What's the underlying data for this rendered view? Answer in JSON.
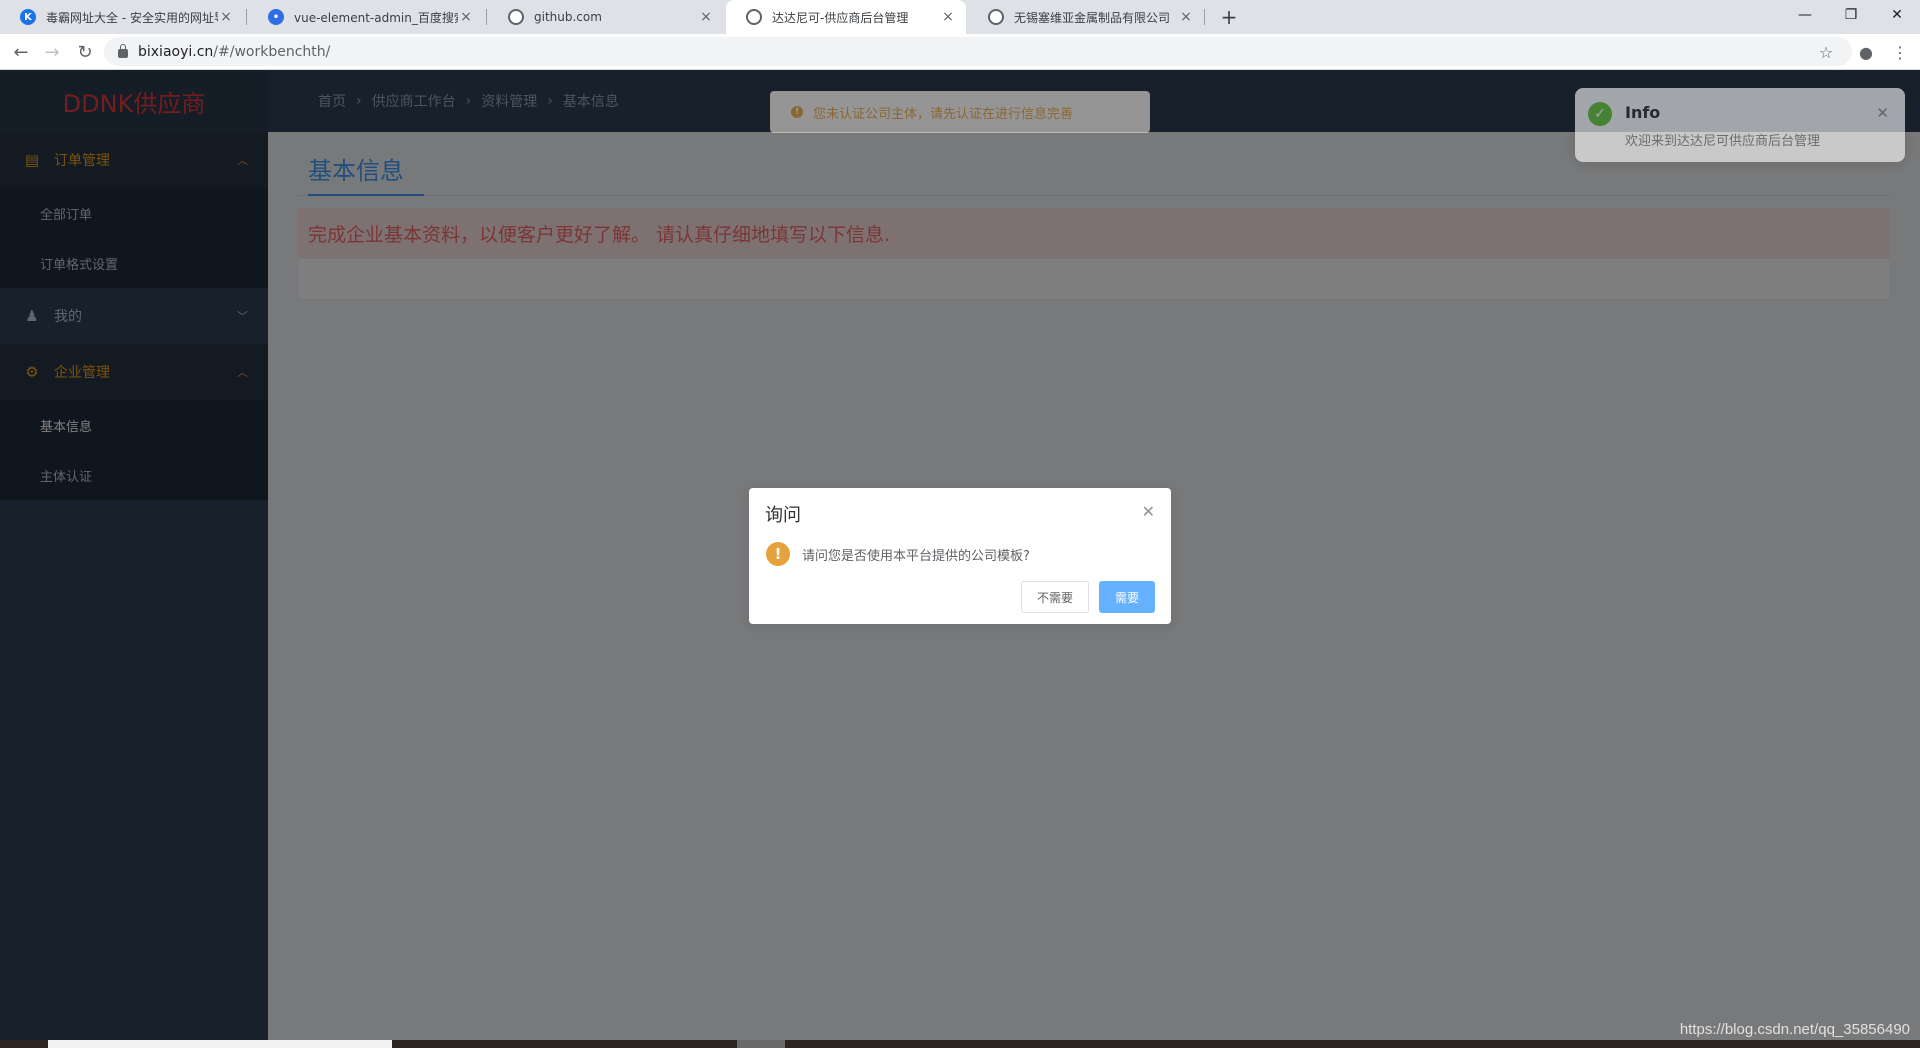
{
  "browser": {
    "tabs": [
      {
        "title": "毒霸网址大全 - 安全实用的网址导",
        "icon": "kingsoft-icon",
        "active": false
      },
      {
        "title": "vue-element-admin_百度搜索",
        "icon": "baidu-icon",
        "active": false
      },
      {
        "title": "github.com",
        "icon": "globe-icon",
        "active": false
      },
      {
        "title": "达达尼可-供应商后台管理",
        "icon": "globe-icon",
        "active": true
      },
      {
        "title": "无锡塞维亚金属制品有限公司",
        "icon": "globe-icon",
        "active": false
      }
    ],
    "url_host": "bixiaoyi.cn",
    "url_path": "/#/workbenchth/"
  },
  "sidebar": {
    "logo": "DDNK供应商",
    "group_order": "订单管理",
    "items_order": [
      {
        "label": "全部订单"
      },
      {
        "label": "订单格式设置"
      }
    ],
    "group_me": "我的",
    "group_company": "企业管理",
    "items_company": [
      {
        "label": "基本信息"
      },
      {
        "label": "主体认证"
      }
    ]
  },
  "breadcrumb": [
    "首页",
    "供应商工作台",
    "资料管理",
    "基本信息"
  ],
  "main": {
    "title": "基本信息",
    "notice": "完成企业基本资料，以便客户更好了解。 请认真仔细地填写以下信息."
  },
  "message": {
    "text": "您未认证公司主体，请先认证在进行信息完善"
  },
  "notification": {
    "title": "Info",
    "body": "欢迎来到达达尼可供应商后台管理"
  },
  "dialog": {
    "title": "询问",
    "message": "请问您是否使用本平台提供的公司模板?",
    "cancel_label": "不需要",
    "confirm_label": "需要"
  },
  "watermark": "https://blog.csdn.net/qq_35856490",
  "colors": {
    "accent": "#409eff",
    "sidebar_bg": "#304156",
    "warning": "#e6a23c",
    "success": "#67c23a",
    "danger": "#f56c6c"
  }
}
